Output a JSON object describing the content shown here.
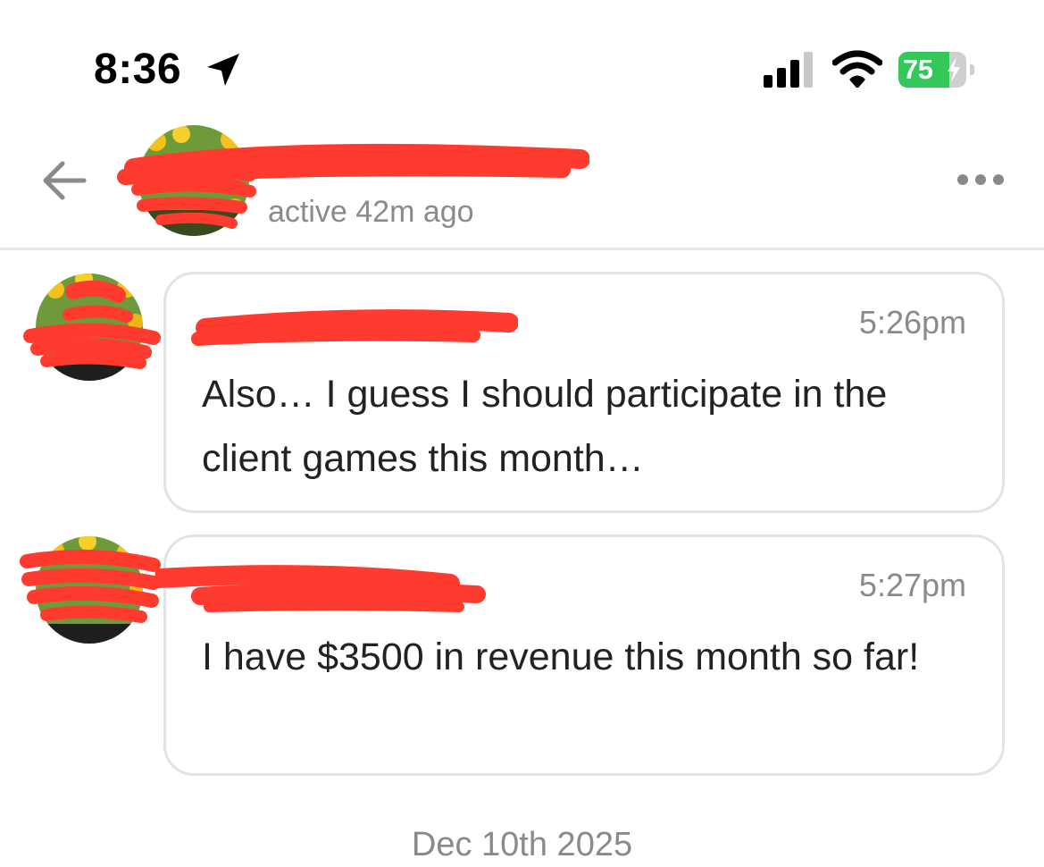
{
  "status_bar": {
    "time": "8:36",
    "battery_level": "75",
    "battery_fraction": 0.75,
    "battery_color": "#34c759",
    "icons": [
      "location-arrow-icon",
      "cellular-signal-icon",
      "wifi-icon",
      "battery-charging-icon"
    ]
  },
  "header": {
    "contact_name": "",
    "last_active": "active 42m ago",
    "back_icon": "back-arrow-icon",
    "menu_icon": "more-horizontal-icon",
    "redaction_color": "#ff3b30"
  },
  "messages": [
    {
      "sender_name": "",
      "time": "5:26pm",
      "text": "Also… I guess I should participate in the client games this month…"
    },
    {
      "sender_name": "",
      "time": "5:27pm",
      "text": "I have $3500 in revenue this month so far!"
    }
  ],
  "date_divider": "Dec 10th 2025"
}
